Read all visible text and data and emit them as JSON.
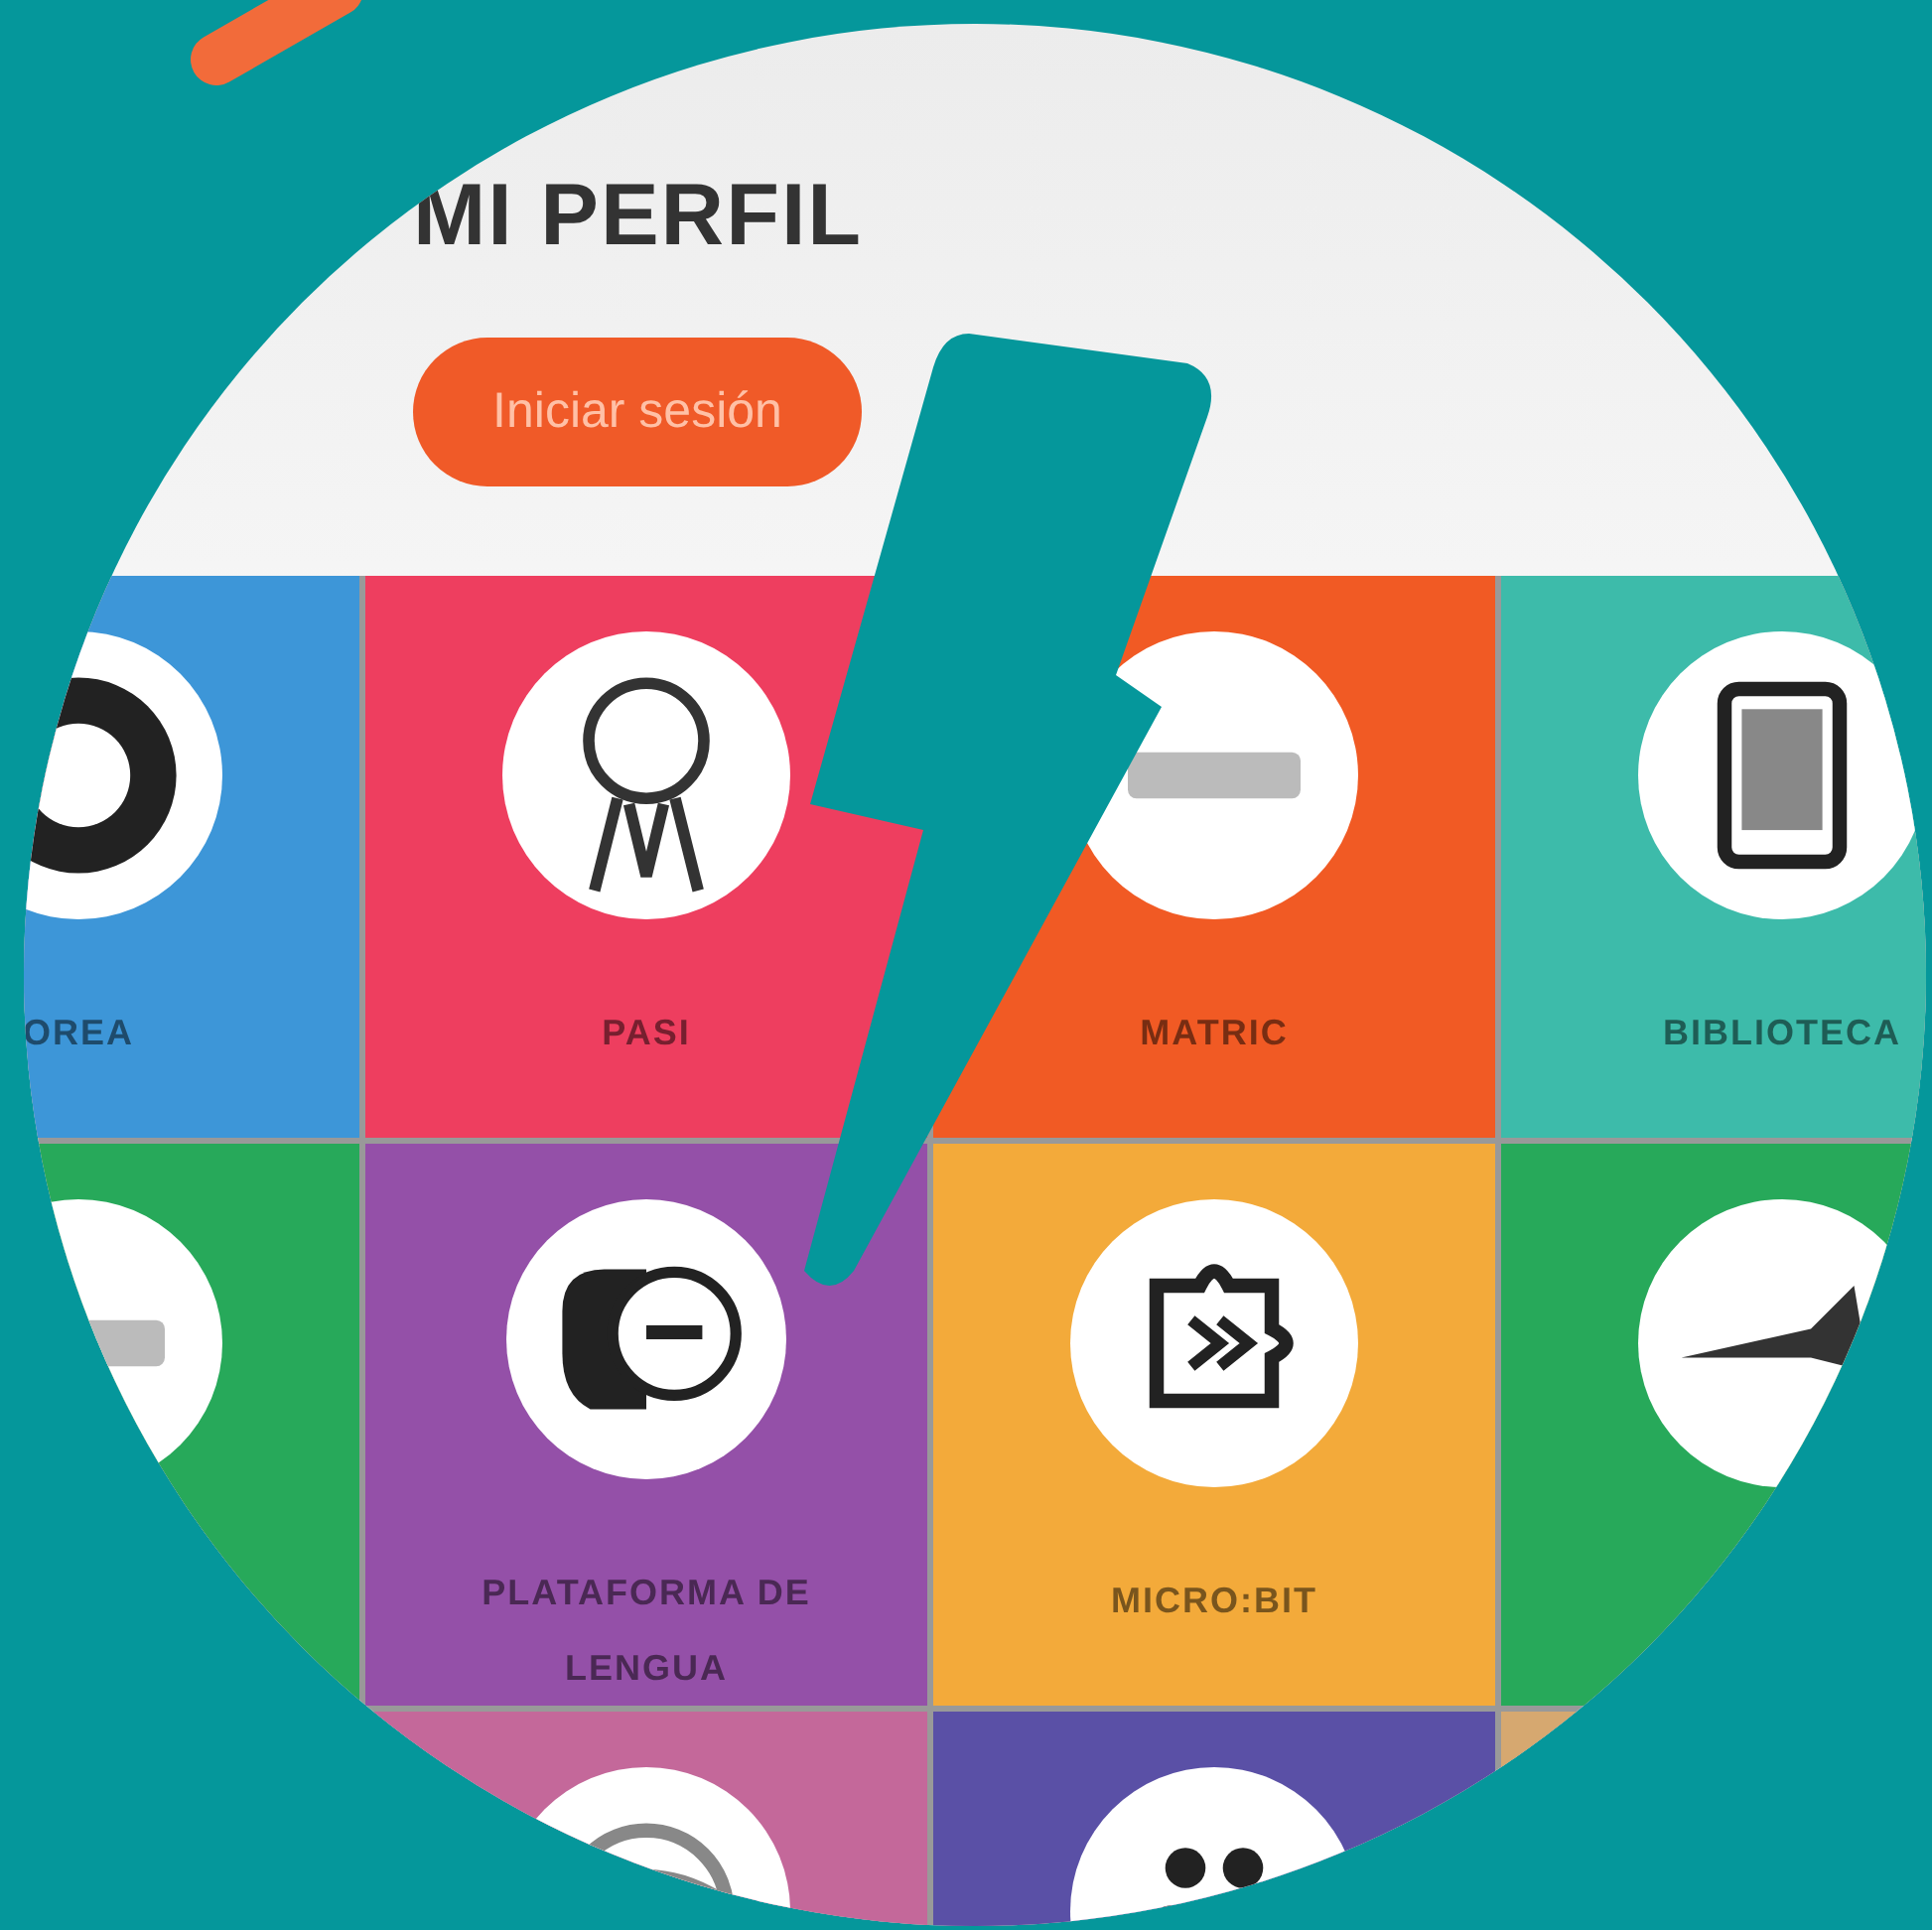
{
  "header": {
    "title": "MI PERFIL",
    "login_button": "Iniciar sesión"
  },
  "tiles": [
    {
      "label": "OREA",
      "color": "#3d96d8",
      "kind": "wheel"
    },
    {
      "label": "PASI",
      "color": "#ee3e5f",
      "kind": "medal"
    },
    {
      "label": "MATRIC",
      "color": "#f15a24",
      "kind": "wordmark"
    },
    {
      "label": "BIBLIOTECA",
      "color": "#3dbbaa",
      "kind": "tablet"
    },
    {
      "color": "#27a95a",
      "kind": "wordmark"
    },
    {
      "label": "PLATAFORMA DE LENGUA",
      "color": "#9450a8",
      "kind": "chat"
    },
    {
      "label": "MICRO:BIT",
      "color": "#f3aa3a",
      "kind": "puzzle"
    },
    {
      "color": "#27a95a",
      "kind": "bird"
    },
    {
      "color": "#c4689a",
      "kind": "globe"
    },
    {
      "color": "#5a50a6",
      "kind": "dots"
    },
    {
      "color": "#d6a870",
      "kind": "blank"
    }
  ]
}
